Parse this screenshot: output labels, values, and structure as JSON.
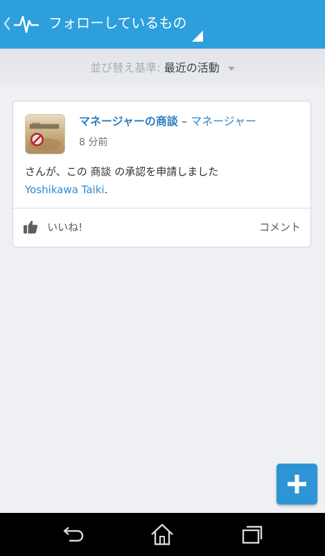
{
  "header": {
    "title": "フォローしているもの",
    "back_icon": "chevron-left-icon",
    "app_icon": "pulse-icon",
    "dropdown_icon": "corner-triangle-icon",
    "color": "#2d9fdd"
  },
  "sort": {
    "label": "並び替え基準:",
    "value": "最近の活動",
    "caret_icon": "caret-down-icon"
  },
  "feed": {
    "items": [
      {
        "group_name": "マネージャーの商談",
        "separator": "–",
        "owner": "マネージャー",
        "time": "8 分前",
        "body_text": "さんが、この 商談 の承認を申請しました",
        "user_link": "Yoshikawa Taiki",
        "period": ".",
        "like_label": "いいね!",
        "comment_label": "コメント",
        "avatar_icon": "no-entry-photo-icon",
        "like_icon": "thumbs-up-icon"
      }
    ]
  },
  "fab": {
    "icon": "plus-icon",
    "color": "#2d95d6"
  },
  "navbar": {
    "back_icon": "back-arrow-icon",
    "home_icon": "home-icon",
    "recents_icon": "recents-icon"
  }
}
